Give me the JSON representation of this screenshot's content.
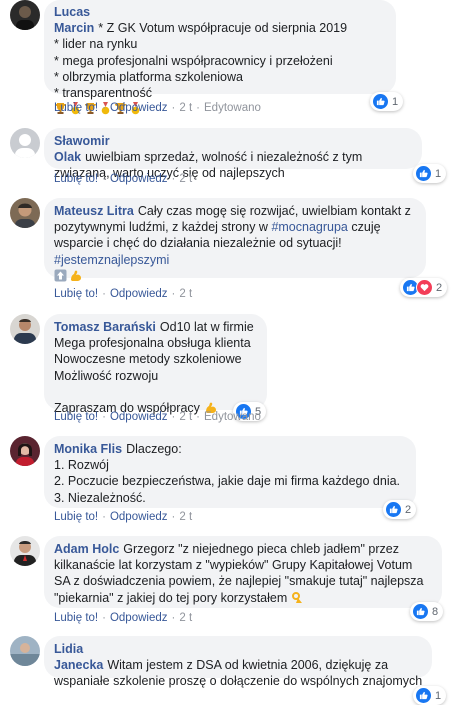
{
  "actions": {
    "like": "Lubię to!",
    "reply": "Odpowiedz",
    "edited": "Edytowano"
  },
  "comments": [
    {
      "author": "Lucas Marcin",
      "lines": [
        "* Z GK Votum współpracuje od sierpnia 2019",
        "* lider na rynku",
        "* mega profesjonalni współpracownicy i przełożeni",
        "* olbrzymia platforma szkoleniowa",
        "* transparentność"
      ],
      "emojis": [
        "trophy-icon",
        "medal-icon",
        "trophy-icon",
        "medal-icon",
        "trophy-icon",
        "medal-icon"
      ],
      "time": "2 t",
      "edited": true,
      "reactions": [
        "like"
      ],
      "reaction_count": "1"
    },
    {
      "author": "Sławomir Olak",
      "lines": [
        "uwielbiam sprzedaż, wolność i niezależność z tym",
        "związaną, warto uczyć się od najlepszych"
      ],
      "time": "2 t",
      "edited": false,
      "reactions": [
        "like"
      ],
      "reaction_count": "1"
    },
    {
      "author": "Mateusz Litra",
      "lines": [
        "Cały czas mogę się rozwijać, uwielbiam kontakt z",
        "pozytywnymi ludźmi, z każdej strony w",
        "wsparcie i chęć do działania niezależnie od sytuacji!",
        ""
      ],
      "line2_hashtag": "#mocnagrupa",
      "line2_tail": " czuję",
      "hashtag_line": "#jestemznajlepszymi",
      "emojis": [
        "up-arrow-icon",
        "flexed-biceps-icon"
      ],
      "time": "2 t",
      "edited": false,
      "reactions": [
        "like",
        "love"
      ],
      "reaction_count": "2"
    },
    {
      "author": "Tomasz Barański",
      "lines": [
        "Od10 lat w firmie",
        "Mega profesjonalna obsługa klienta",
        "Nowoczesne metody szkoleniowe",
        "Możliwość rozwoju",
        "",
        "Zapraszam do współpracy"
      ],
      "time": "2 t",
      "edited": true,
      "reactions": [
        "like"
      ],
      "reaction_count": "5"
    },
    {
      "author": "Monika Flis",
      "lines": [
        "Dlaczego:",
        "1. Rozwój",
        "2. Poczucie bezpieczeństwa, jakie daje mi firma każdego dnia.",
        "3. Niezależność."
      ],
      "time": "2 t",
      "edited": false,
      "reactions": [
        "like"
      ],
      "reaction_count": "2"
    },
    {
      "author": "Adam Holc",
      "lines": [
        "Grzegorz \"z niejednego pieca chleb jadłem\" przez",
        "kilkanaście lat korzystam z \"wypieków\" Grupy Kapitałowej Votum",
        "SA z doświadczenia powiem, że najlepiej \"smakuje tutaj\" najlepsza",
        "\"piekarnia\" z jakiej do tej pory korzystałem"
      ],
      "time": "2 t",
      "edited": false,
      "reactions": [
        "like"
      ],
      "reaction_count": "8"
    },
    {
      "author": "Lidia Janecka",
      "lines": [
        "Witam jestem z DSA od kwietnia 2006, dziękuję za",
        "wspaniałe szkolenie proszę o dołączenie do wspólnych znajomych"
      ],
      "reactions": [
        "like"
      ],
      "reaction_count": "1"
    }
  ],
  "colors": {
    "link": "#385898",
    "bubble": "#f2f3f5",
    "like": "#1877f2",
    "love": "#f33e58",
    "muted": "#90949c"
  }
}
